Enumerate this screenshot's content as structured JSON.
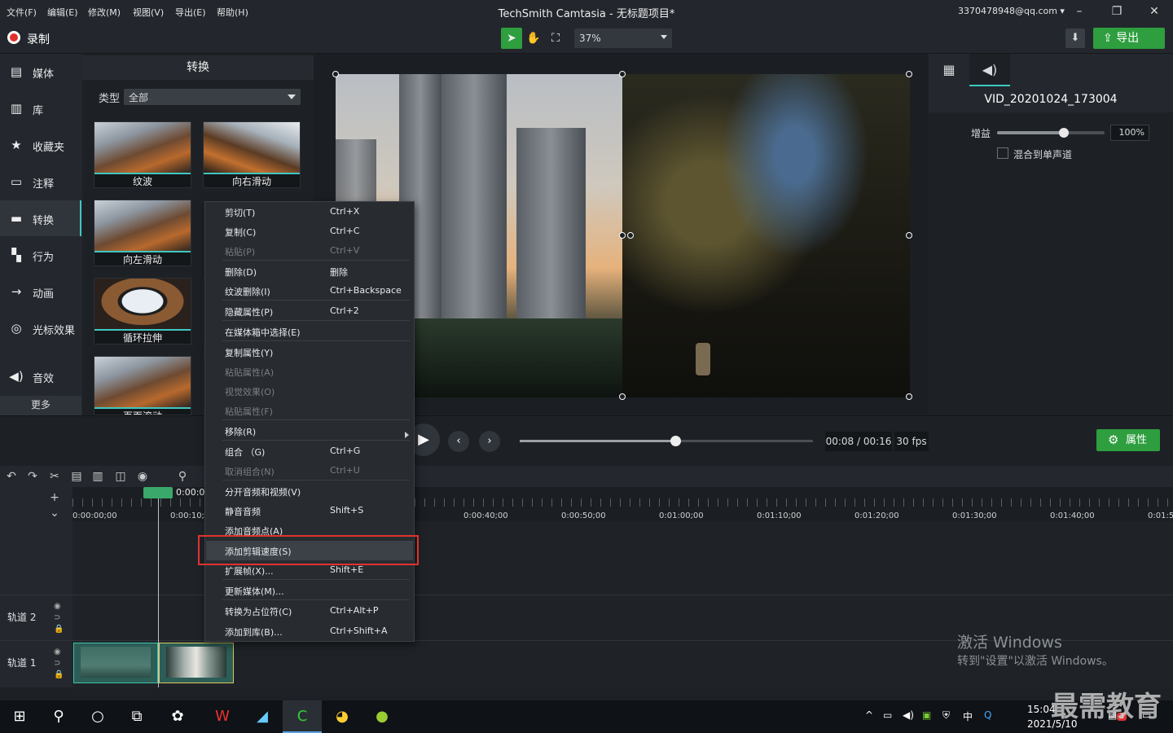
{
  "menubar": [
    "文件(F)",
    "编辑(E)",
    "修改(M)",
    "视图(V)",
    "导出(E)",
    "帮助(H)"
  ],
  "window_title": "TechSmith Camtasia - 无标题项目*",
  "account": "3370478948@qq.com ▾",
  "toolbar": {
    "record_label": "录制",
    "zoom": "37%",
    "export_label": "导出"
  },
  "sidebar": {
    "items": [
      {
        "label": "媒体",
        "icon": "media-icon"
      },
      {
        "label": "库",
        "icon": "library-icon"
      },
      {
        "label": "收藏夹",
        "icon": "star-icon"
      },
      {
        "label": "注释",
        "icon": "annotation-icon"
      },
      {
        "label": "转换",
        "icon": "transition-icon"
      },
      {
        "label": "行为",
        "icon": "behavior-icon"
      },
      {
        "label": "动画",
        "icon": "animation-icon"
      },
      {
        "label": "光标效果",
        "icon": "cursor-icon"
      },
      {
        "label": "音效",
        "icon": "audio-icon"
      }
    ],
    "more": "更多"
  },
  "transitions": {
    "title": "转换",
    "type_label": "类型",
    "type_value": "全部",
    "thumbs": [
      "纹波",
      "向右滑动",
      "向左滑动",
      "循环拉伸",
      "页面滚动"
    ]
  },
  "properties": {
    "clip_name": "VID_20201024_173004",
    "gain_label": "增益",
    "gain_value": "100%",
    "gain_fraction": 0.62,
    "mono_label": "混合到单声道"
  },
  "playback": {
    "timecode": "00:08 / 00:16",
    "fps": "30 fps",
    "progress": 0.53,
    "props_button": "属性"
  },
  "timeline": {
    "playhead_time": "0:00:0",
    "ticks": [
      "0:00:00;00",
      "0:00:10;",
      "0:00:40;00",
      "0:00:50;00",
      "0:01:00;00",
      "0:01:10;00",
      "0:01:20;00",
      "0:01:30;00",
      "0:01:40;00",
      "0:01:5"
    ],
    "tracks": [
      "轨道 2",
      "轨道 1"
    ]
  },
  "context_menu": [
    {
      "label": "剪切(T)",
      "shortcut": "Ctrl+X",
      "disabled": false
    },
    {
      "label": "复制(C)",
      "shortcut": "Ctrl+C",
      "disabled": false
    },
    {
      "label": "粘贴(P)",
      "shortcut": "Ctrl+V",
      "disabled": true,
      "sep": true
    },
    {
      "label": "删除(D)",
      "shortcut": "删除",
      "disabled": false
    },
    {
      "label": "纹波删除(I)",
      "shortcut": "Ctrl+Backspace",
      "disabled": false,
      "sep": true
    },
    {
      "label": "隐藏属性(P)",
      "shortcut": "Ctrl+2",
      "disabled": false,
      "sep": true
    },
    {
      "label": "在媒体箱中选择(E)",
      "shortcut": "",
      "disabled": false,
      "sep": true
    },
    {
      "label": "复制属性(Y)",
      "shortcut": "",
      "disabled": false
    },
    {
      "label": "粘贴属性(A)",
      "shortcut": "",
      "disabled": true
    },
    {
      "label": "视觉效果(O)",
      "shortcut": "",
      "disabled": true
    },
    {
      "label": "粘贴属性(F)",
      "shortcut": "",
      "disabled": true,
      "sep": true
    },
    {
      "label": "移除(R)",
      "shortcut": "",
      "disabled": false,
      "sep": true
    },
    {
      "label": "组合 （G)",
      "shortcut": "Ctrl+G",
      "disabled": false
    },
    {
      "label": "取消组合(N)",
      "shortcut": "Ctrl+U",
      "disabled": true,
      "sep": true
    },
    {
      "label": "分开音频和视频(V)",
      "shortcut": "",
      "disabled": false
    },
    {
      "label": "静音音频",
      "shortcut": "Shift+S",
      "disabled": false
    },
    {
      "label": "添加音频点(A)",
      "shortcut": "",
      "disabled": false
    },
    {
      "label": "添加剪辑速度(S)",
      "shortcut": "",
      "disabled": false,
      "highlight": true
    },
    {
      "label": "扩展帧(X)...",
      "shortcut": "Shift+E",
      "disabled": false,
      "sep": true
    },
    {
      "label": "更新媒体(M)...",
      "shortcut": "",
      "disabled": false,
      "sep": true
    },
    {
      "label": "转换为占位符(C)",
      "shortcut": "Ctrl+Alt+P",
      "disabled": false
    },
    {
      "label": "添加到库(B)...",
      "shortcut": "Ctrl+Shift+A",
      "disabled": false
    }
  ],
  "watermark": {
    "line1": "激活 Windows",
    "line2": "转到\"设置\"以激活 Windows。",
    "brand": "最需教育"
  },
  "taskbar": {
    "time": "15:04",
    "date": "2021/5/10",
    "ime": "中",
    "badge": "3"
  }
}
